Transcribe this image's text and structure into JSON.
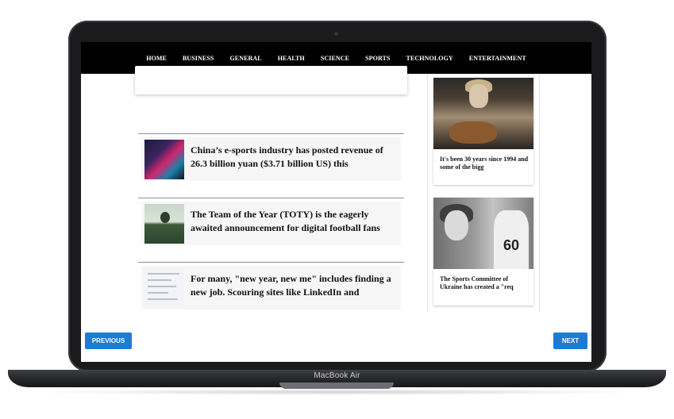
{
  "device": {
    "label": "MacBook Air"
  },
  "nav": {
    "items": [
      "HOME",
      "BUSINESS",
      "GENERAL",
      "HEALTH",
      "SCIENCE",
      "SPORTS",
      "TECHNOLOGY",
      "ENTERTAINMENT"
    ]
  },
  "articles": [
    {
      "title": "China’s e-sports industry has posted revenue of 26.3 billion yuan ($3.71 billion US) this",
      "thumb": "esports-image"
    },
    {
      "title": "The Team of the Year (TOTY) is the eagerly awaited announcement for digital football fans",
      "thumb": "football-field-image"
    },
    {
      "title": "For many, \"new year, new me\" includes finding a new job. Scouring sites like LinkedIn and",
      "thumb": "job-site-screenshot"
    }
  ],
  "sidebar": {
    "cards": [
      {
        "caption": "It's been 30 years since 1994 and some of the bigg",
        "image": "musician-guitar-photo"
      },
      {
        "caption": "The Sports Committee of Ukraine has created a \"req",
        "image": "athletes-photo",
        "jersey_number": "60"
      }
    ]
  },
  "pagination": {
    "previous_label": "PREVIOUS",
    "next_label": "NEXT"
  },
  "colors": {
    "navbar": "#000000",
    "button": "#1e7bd4",
    "laptop_frame": "#1b1b1d"
  }
}
